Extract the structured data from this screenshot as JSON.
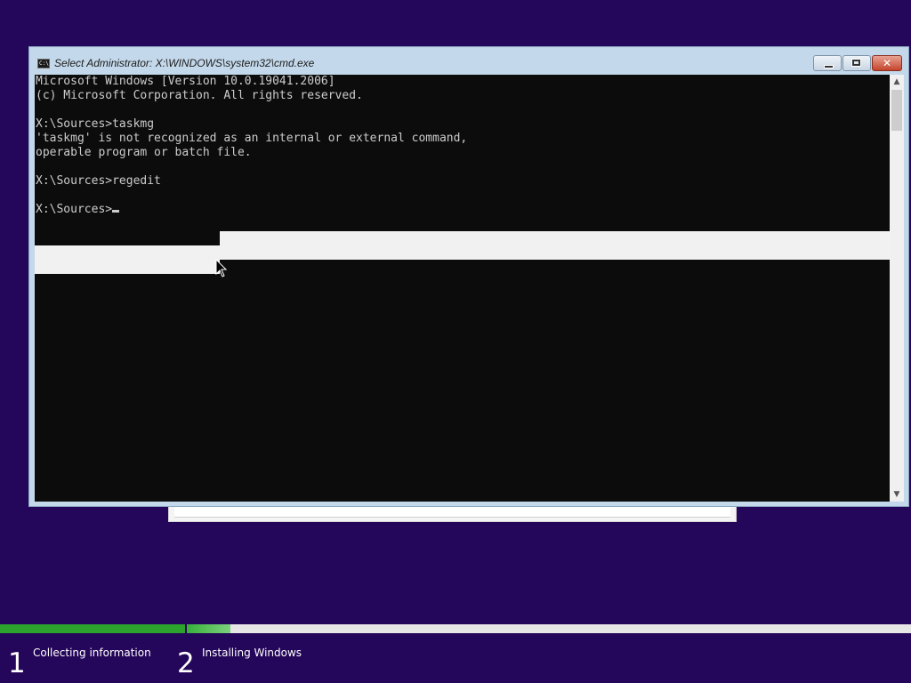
{
  "window": {
    "title": "Select Administrator: X:\\WINDOWS\\system32\\cmd.exe",
    "icon_label": "C:\\",
    "close_glyph": "✕"
  },
  "console": {
    "lines": [
      "Microsoft Windows [Version 10.0.19041.2006]",
      "(c) Microsoft Corporation. All rights reserved.",
      "",
      "X:\\Sources>taskmg",
      "'taskmg' is not recognized as an internal or external command,",
      "operable program or batch file.",
      "",
      "X:\\Sources>regedit",
      ""
    ],
    "prompt": "X:\\Sources>"
  },
  "scrollbar": {
    "up_arrow": "▲",
    "down_arrow": "▼"
  },
  "setup_progress": {
    "steps": [
      {
        "number": "1",
        "label": "Collecting information"
      },
      {
        "number": "2",
        "label": "Installing Windows"
      }
    ],
    "step1_progress": 1.0,
    "step2_progress": 0.06
  },
  "colors": {
    "desktop_bg": "#24065a",
    "console_bg": "#0c0c0c",
    "console_text": "#cccccc",
    "progress_green": "#2ba32c"
  }
}
